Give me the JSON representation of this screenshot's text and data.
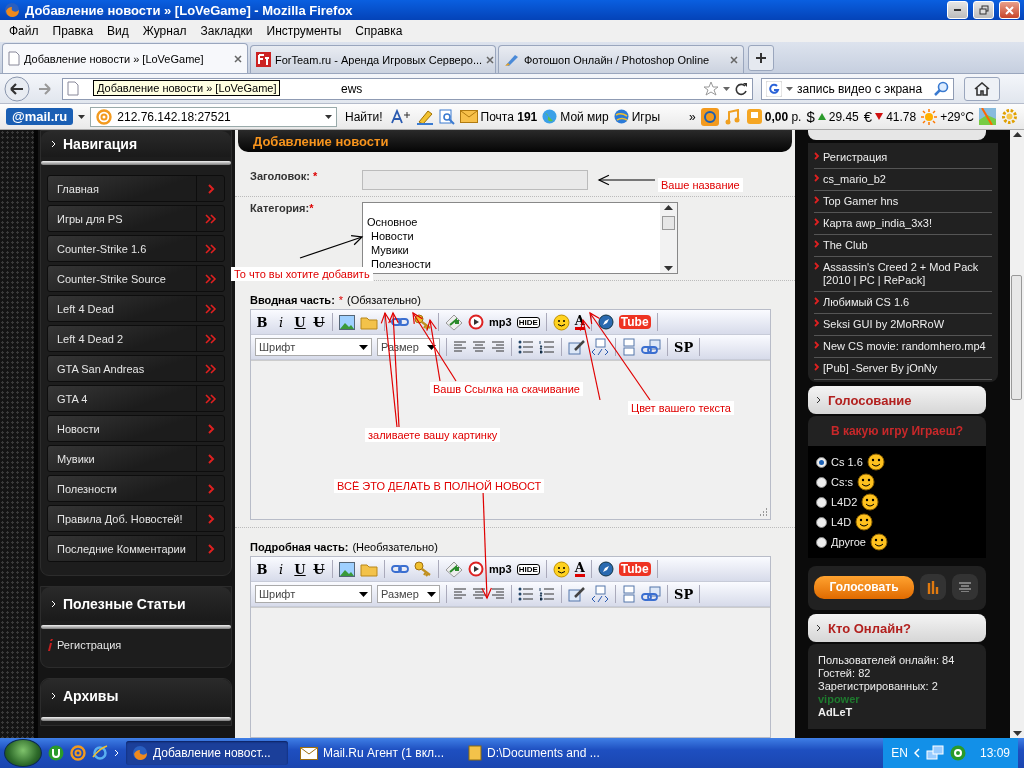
{
  "window": {
    "title": "Добавление новости » [LoVeGame] - Mozilla Firefox"
  },
  "menu": [
    "Файл",
    "Правка",
    "Вид",
    "Журнал",
    "Закладки",
    "Инструменты",
    "Справка"
  ],
  "tabs": [
    {
      "label": "Добавление новости » [LoVeGame]",
      "selected": true
    },
    {
      "label": "ForTeam.ru - Аренда Игровых Серверо...",
      "selected": false
    },
    {
      "label": "Фотошоп Онлайн / Photoshop Online",
      "selected": false
    }
  ],
  "address_bar": {
    "value": "ews",
    "tooltip": "Добавление новости » [LoVeGame]"
  },
  "search": {
    "value": "запись видео с экрана"
  },
  "mail_toolbar": {
    "logo": "@mail.ru",
    "field": "212.76.142.18:27521",
    "find_button": "Найти!",
    "mail": "Почта **191**",
    "my_world": "Мой мир",
    "games": "Игры",
    "more": "»",
    "balance": "**0,00** р.",
    "currencies": [
      {
        "symbol": "$",
        "value": "29.45",
        "rising": true
      },
      {
        "symbol": "€",
        "value": "41.78",
        "rising": false
      }
    ],
    "weather": "+29°C"
  },
  "navigation": {
    "title": "Навигация",
    "items": [
      {
        "label": "Главная",
        "kind": "single"
      },
      {
        "label": "Игры для PS",
        "kind": "double"
      },
      {
        "label": "Counter-Strike 1.6",
        "kind": "double"
      },
      {
        "label": "Counter-Strike Source",
        "kind": "double"
      },
      {
        "label": "Left 4 Dead",
        "kind": "double"
      },
      {
        "label": "Left 4 Dead 2",
        "kind": "double"
      },
      {
        "label": "GTA San Andreas",
        "kind": "double"
      },
      {
        "label": "GTA 4",
        "kind": "double"
      },
      {
        "label": "Новости",
        "kind": "single"
      },
      {
        "label": "Мувики",
        "kind": "single"
      },
      {
        "label": "Полезности",
        "kind": "single"
      },
      {
        "label": "Правила Доб. Новостей!",
        "kind": "single"
      },
      {
        "label": "Последние Комментарии",
        "kind": "single"
      }
    ]
  },
  "articles": {
    "title": "Полезные Статьи",
    "items": [
      "Регистрация"
    ]
  },
  "archives": {
    "title": "Архивы"
  },
  "form": {
    "heading": "Добавление новости",
    "title_label": "Заголовок:",
    "title_required": "*",
    "category_label": "Категория:",
    "category_required": "*",
    "categories": [
      {
        "label": "Основное",
        "children": [
          {
            "label": "Новости"
          },
          {
            "label": "Мувики"
          },
          {
            "label": "Полезности"
          }
        ]
      }
    ],
    "editors": [
      {
        "label": "Вводная часть:",
        "required": "*",
        "hint": "(Обязательно)",
        "row1": [
          {
            "kind": "bold",
            "glyph": "B"
          },
          {
            "kind": "italic",
            "glyph": "i"
          },
          {
            "kind": "underline",
            "glyph": "U"
          },
          {
            "kind": "strike",
            "glyph": "U"
          },
          {
            "kind": "sep"
          },
          {
            "kind": "image"
          },
          {
            "kind": "folder"
          },
          {
            "kind": "sep"
          },
          {
            "kind": "link"
          },
          {
            "kind": "key"
          },
          {
            "kind": "sep"
          },
          {
            "kind": "flash"
          },
          {
            "kind": "play"
          },
          {
            "kind": "mp3",
            "glyph": "mp3"
          },
          {
            "kind": "hide",
            "glyph": "HIDE"
          },
          {
            "kind": "sep"
          },
          {
            "kind": "smile"
          },
          {
            "kind": "color",
            "glyph": "A"
          },
          {
            "kind": "sep"
          },
          {
            "kind": "compass"
          },
          {
            "kind": "youtube",
            "glyph": "Tube"
          },
          {
            "kind": "sep"
          }
        ],
        "row2": [
          {
            "kind": "font-select",
            "glyph": "Шрифт"
          },
          {
            "kind": "size-select",
            "glyph": "Размер"
          },
          {
            "kind": "sep"
          },
          {
            "kind": "align-left"
          },
          {
            "kind": "align-center"
          },
          {
            "kind": "align-right"
          },
          {
            "kind": "sep"
          },
          {
            "kind": "bullets"
          },
          {
            "kind": "numbers"
          },
          {
            "kind": "sep"
          },
          {
            "kind": "edit"
          },
          {
            "kind": "code"
          },
          {
            "kind": "sep"
          },
          {
            "kind": "page"
          },
          {
            "kind": "chain-page"
          },
          {
            "kind": "sep"
          },
          {
            "kind": "sp",
            "glyph": "SP"
          },
          {
            "kind": "sep"
          }
        ]
      },
      {
        "label": "Подробная часть:",
        "hint": "(Необязательно)",
        "row1": [
          {
            "kind": "bold",
            "glyph": "B"
          },
          {
            "kind": "italic",
            "glyph": "i"
          },
          {
            "kind": "underline",
            "glyph": "U"
          },
          {
            "kind": "strike",
            "glyph": "U"
          },
          {
            "kind": "sep"
          },
          {
            "kind": "image"
          },
          {
            "kind": "folder"
          },
          {
            "kind": "sep"
          },
          {
            "kind": "link"
          },
          {
            "kind": "key"
          },
          {
            "kind": "sep"
          },
          {
            "kind": "flash"
          },
          {
            "kind": "play"
          },
          {
            "kind": "mp3",
            "glyph": "mp3"
          },
          {
            "kind": "hide",
            "glyph": "HIDE"
          },
          {
            "kind": "sep"
          },
          {
            "kind": "smile"
          },
          {
            "kind": "color",
            "glyph": "A"
          },
          {
            "kind": "sep"
          },
          {
            "kind": "compass"
          },
          {
            "kind": "youtube",
            "glyph": "Tube"
          },
          {
            "kind": "sep"
          }
        ],
        "row2": [
          {
            "kind": "font-select",
            "glyph": "Шрифт"
          },
          {
            "kind": "size-select",
            "glyph": "Размер"
          },
          {
            "kind": "sep"
          },
          {
            "kind": "align-left"
          },
          {
            "kind": "align-center"
          },
          {
            "kind": "align-right"
          },
          {
            "kind": "sep"
          },
          {
            "kind": "bullets"
          },
          {
            "kind": "numbers"
          },
          {
            "kind": "sep"
          },
          {
            "kind": "edit"
          },
          {
            "kind": "code"
          },
          {
            "kind": "sep"
          },
          {
            "kind": "page"
          },
          {
            "kind": "chain-page"
          },
          {
            "kind": "sep"
          },
          {
            "kind": "sp",
            "glyph": "SP"
          },
          {
            "kind": "sep"
          }
        ]
      }
    ]
  },
  "annotations": [
    "Ваше название",
    "То что вы хотите добавить",
    "Вашв Ссылка на скачивание",
    "Цвет вашего текста",
    "заливаете вашу картинку",
    "ВСЁ ЭТО ДЕЛАТЬ В ПОЛНОЙ НОВОСТ"
  ],
  "popular": [
    "Регистрация",
    "cs_mario_b2",
    "Top Gamer hns",
    "Карта awp_india_3x3!",
    "The Club",
    "Assassin's Creed 2 + Mod Pack [2010 | PC | RePack]",
    "Любимый CS 1.6",
    "Seksi GUI by 2MoRRoW",
    "New CS movie: randomhero.mp4",
    "[Pub] -Server By jOnNy"
  ],
  "poll": {
    "title": "Голосование",
    "question": "В какую игру Играеш?",
    "options": [
      {
        "label": "Cs 1.6",
        "selected": true
      },
      {
        "label": "Cs:s",
        "selected": false
      },
      {
        "label": "L4D2",
        "selected": false
      },
      {
        "label": "L4D",
        "selected": false
      },
      {
        "label": "Другое",
        "selected": false
      }
    ],
    "vote_button": "Голосовать"
  },
  "online": {
    "title": "Кто Онлайн?",
    "lines": [
      "Пользователей онлайн: 84",
      "Гостей: 82",
      "Зарегистрированных: 2"
    ],
    "users": [
      {
        "name": "vipower",
        "color": "#1e7a2e"
      },
      {
        "name": "AdLeT",
        "color": "#f0f0f0"
      }
    ]
  },
  "taskbar": {
    "tasks": [
      {
        "label": "Добавление новост...",
        "selected": true
      },
      {
        "label": "Mail.Ru Агент (1 вкл...",
        "selected": false
      },
      {
        "label": "D:\\Documents and ...",
        "selected": false
      }
    ],
    "language": "EN",
    "clock": "13:09"
  }
}
